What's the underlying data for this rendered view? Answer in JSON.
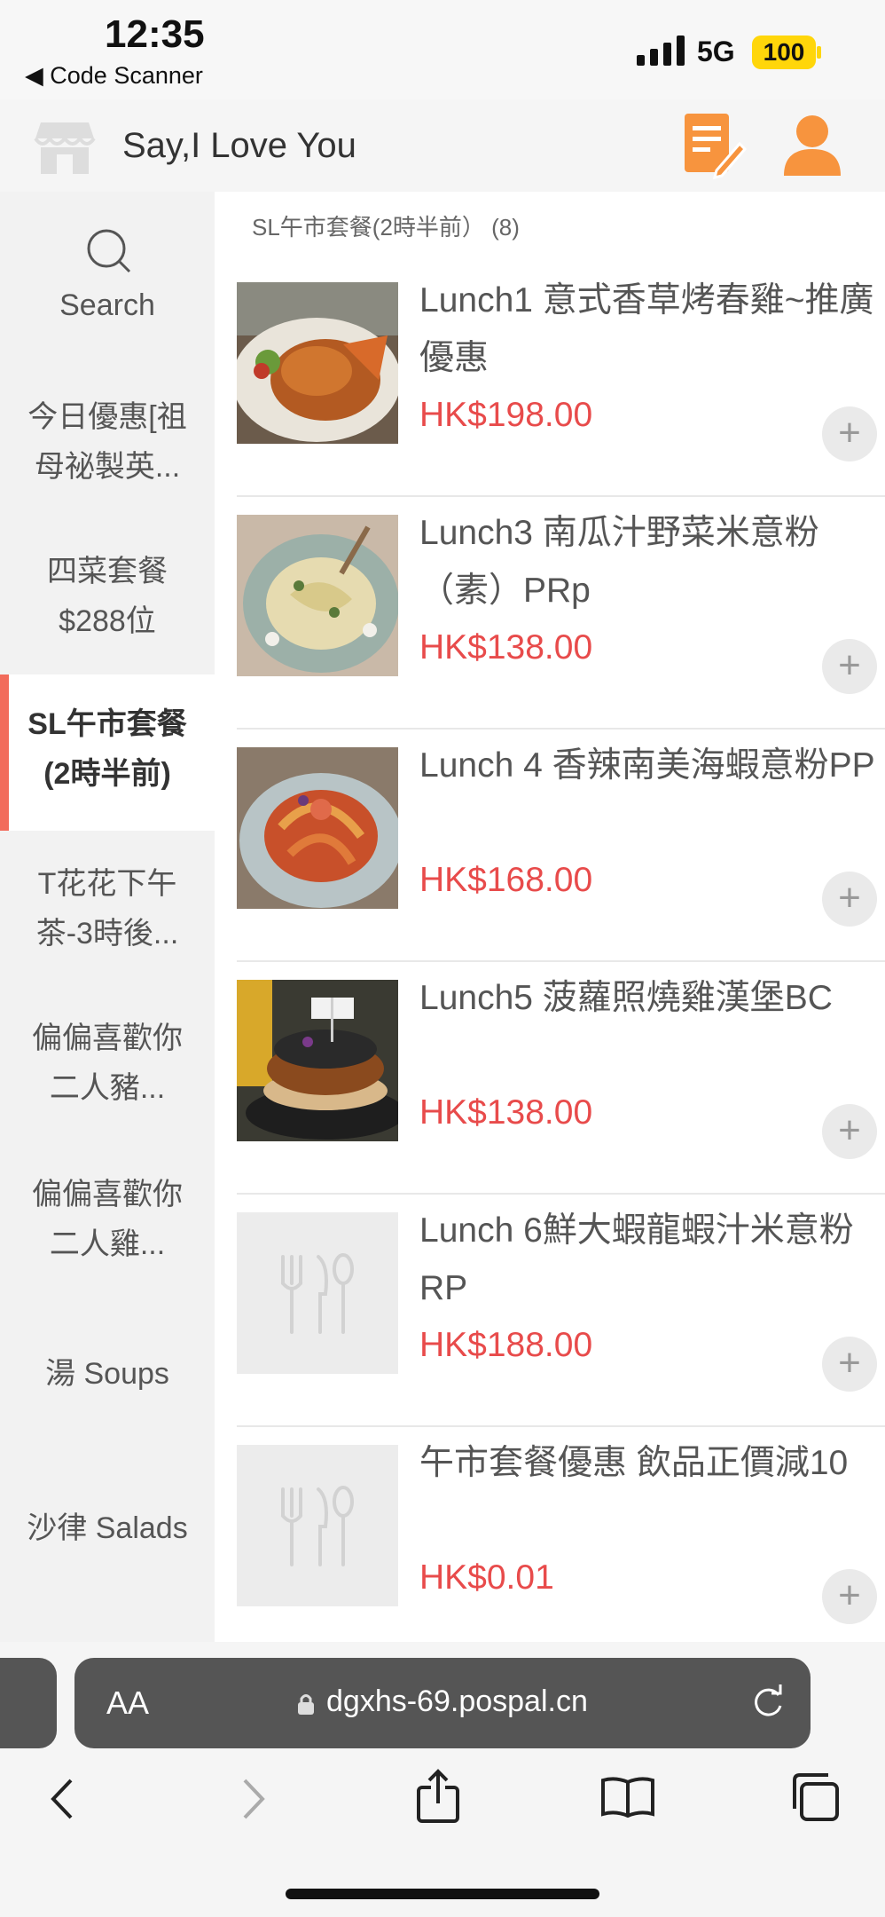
{
  "status": {
    "time": "12:35",
    "back_app": "◀ Code Scanner",
    "network": "5G",
    "battery": "100"
  },
  "header": {
    "store_name": "Say,I Love You"
  },
  "sidebar": {
    "search_label": "Search",
    "items": [
      {
        "line1": "今日優惠[祖",
        "line2": "母祕製英..."
      },
      {
        "line1": "四菜套餐",
        "line2": "$288位"
      },
      {
        "line1": "SL午市套餐",
        "line2": "(2時半前)"
      },
      {
        "line1": "T花花下午",
        "line2": "茶-3時後..."
      },
      {
        "line1": "偏偏喜歡你",
        "line2": "二人豬..."
      },
      {
        "line1": "偏偏喜歡你",
        "line2": "二人雞..."
      },
      {
        "line1": "湯 Soups",
        "line2": ""
      },
      {
        "line1": "沙律 Salads",
        "line2": ""
      }
    ]
  },
  "main": {
    "category_title": "SL午市套餐(2時半前） (8)",
    "products": [
      {
        "name": "Lunch1 意式香草烤春雞~推廣優惠",
        "price": "HK$198.00",
        "image": "roast-chicken"
      },
      {
        "name": "Lunch3 南瓜汁野菜米意粉（素）PRp",
        "price": "HK$138.00",
        "image": "pasta-cream"
      },
      {
        "name": "Lunch 4 香辣南美海蝦意粉PP",
        "price": "HK$168.00",
        "image": "shrimp-pasta"
      },
      {
        "name": "Lunch5 菠蘿照燒雞漢堡BC",
        "price": "HK$138.00",
        "image": "chicken-burger"
      },
      {
        "name": "Lunch 6鮮大蝦龍蝦汁米意粉 RP",
        "price": "HK$188.00",
        "image": "placeholder"
      },
      {
        "name": "午市套餐優惠 飲品正價減10",
        "price": "HK$0.01",
        "image": "placeholder"
      }
    ]
  },
  "browser": {
    "aa": "AA",
    "url": "dgxhs-69.pospal.cn"
  },
  "colors": {
    "accent": "#f26b5b",
    "price": "#e84b4b",
    "orange_icon": "#f7943e"
  }
}
